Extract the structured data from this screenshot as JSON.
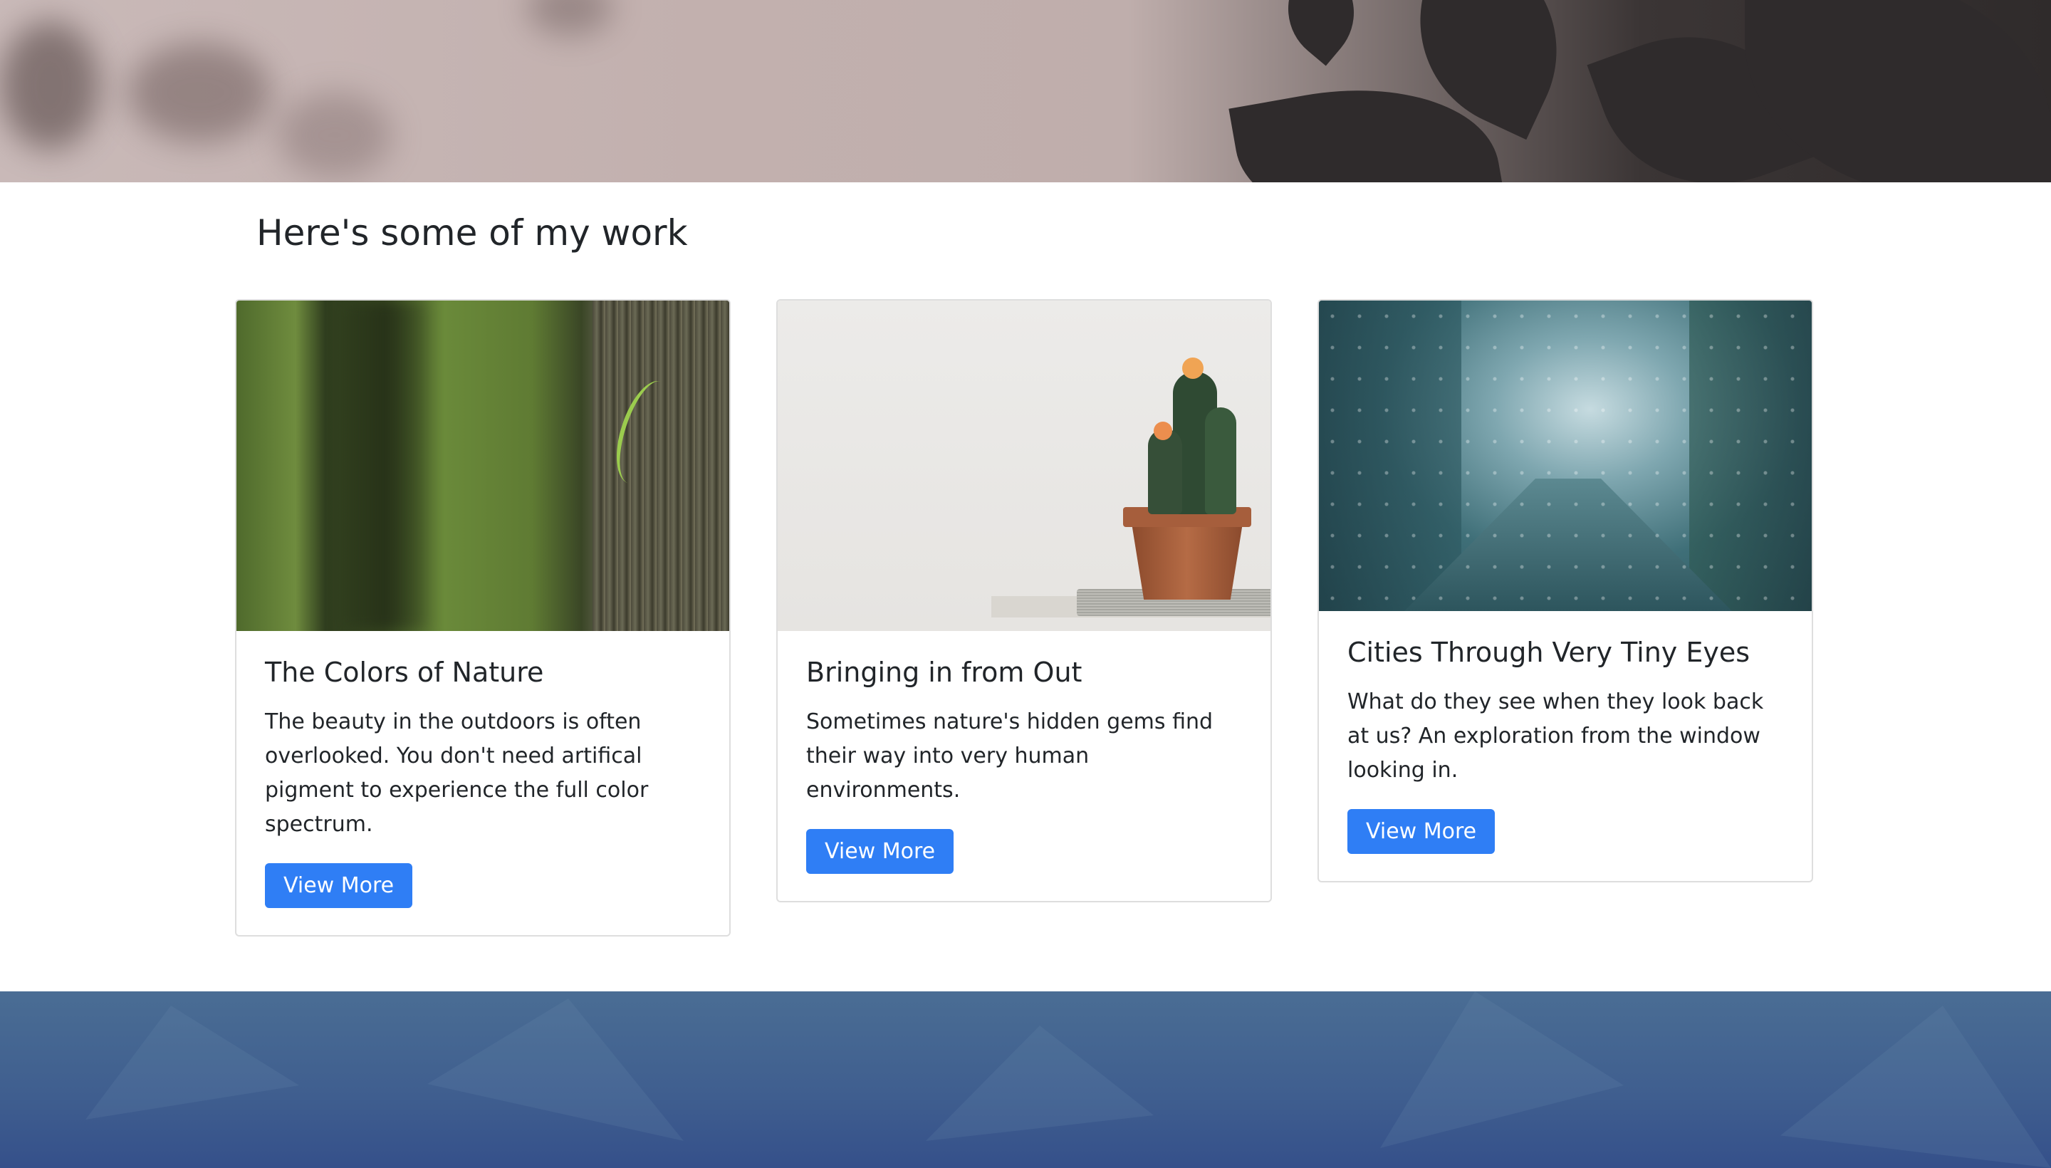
{
  "section": {
    "title": "Here's some of my work"
  },
  "cards": [
    {
      "title": "The Colors of Nature",
      "text": "The beauty in the outdoors is often overlooked. You don't need artifical pigment to experience the full color spectrum.",
      "button": "View More",
      "image": "forest-tree-photo"
    },
    {
      "title": "Bringing in from Out",
      "text": "Sometimes nature's hidden gems find their way into very human environments.",
      "button": "View More",
      "image": "potted-cactus-photo"
    },
    {
      "title": "Cities Through Very Tiny Eyes",
      "text": "What do they see when they look back at us? An exploration from the window looking in.",
      "button": "View More",
      "image": "rainy-city-window-photo"
    }
  ],
  "colors": {
    "accent": "#2f7ef5",
    "footer": "#3f5e8f"
  }
}
